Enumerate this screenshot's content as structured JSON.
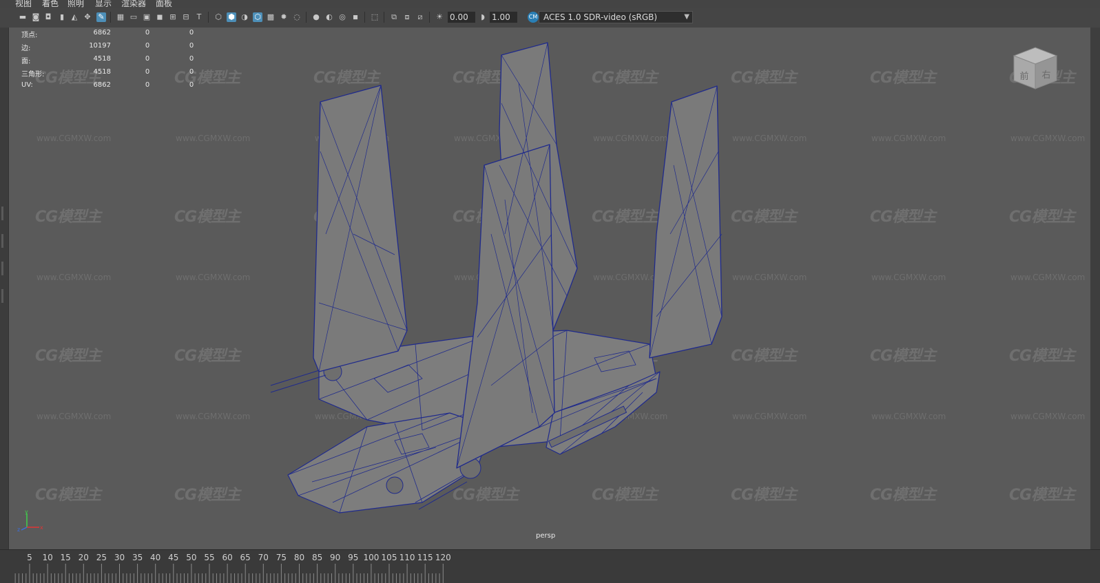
{
  "menu": [
    "视图",
    "着色",
    "照明",
    "显示",
    "渲染器",
    "面板"
  ],
  "toolbar": {
    "exposure_value": "0.00",
    "gamma_value": "1.00",
    "color_space": "ACES 1.0 SDR-video (sRGB)",
    "icons": [
      "camera-icon",
      "bookmark-icon",
      "image-plane-icon",
      "grid-icon",
      "film-gate-icon",
      "resolution-gate-icon",
      "wireframe-icon",
      "smooth-shade-icon",
      "textured-icon",
      "lighting-icon",
      "shadow-icon",
      "isolate-icon",
      "xray-icon"
    ]
  },
  "hud": {
    "rows": [
      {
        "label": "顶点:",
        "v1": "6862",
        "v2": "0",
        "v3": "0"
      },
      {
        "label": "边:",
        "v1": "10197",
        "v2": "0",
        "v3": "0"
      },
      {
        "label": "面:",
        "v1": "4518",
        "v2": "0",
        "v3": "0"
      },
      {
        "label": "三角形:",
        "v1": "4518",
        "v2": "0",
        "v3": "0"
      },
      {
        "label": "UV:",
        "v1": "6862",
        "v2": "0",
        "v3": "0"
      }
    ]
  },
  "viewport": {
    "camera": "persp",
    "viewcube_faces": [
      "前",
      "右"
    ],
    "axis_labels": [
      "y",
      "z",
      "x"
    ],
    "watermark_logo": "CG模型主",
    "watermark_url": "www.CGMXW.com"
  },
  "timeline": {
    "ticks": [
      "5",
      "10",
      "15",
      "20",
      "25",
      "30",
      "35",
      "40",
      "45",
      "50",
      "55",
      "60",
      "65",
      "70",
      "75",
      "80",
      "85",
      "90",
      "95",
      "100",
      "105",
      "110",
      "115",
      "120"
    ]
  },
  "colors": {
    "viewport_bg": "#5a5a5a",
    "wireframe": "#1f2a8c",
    "surface": "#7e7e7e",
    "highlight": "#4d8fb8"
  }
}
